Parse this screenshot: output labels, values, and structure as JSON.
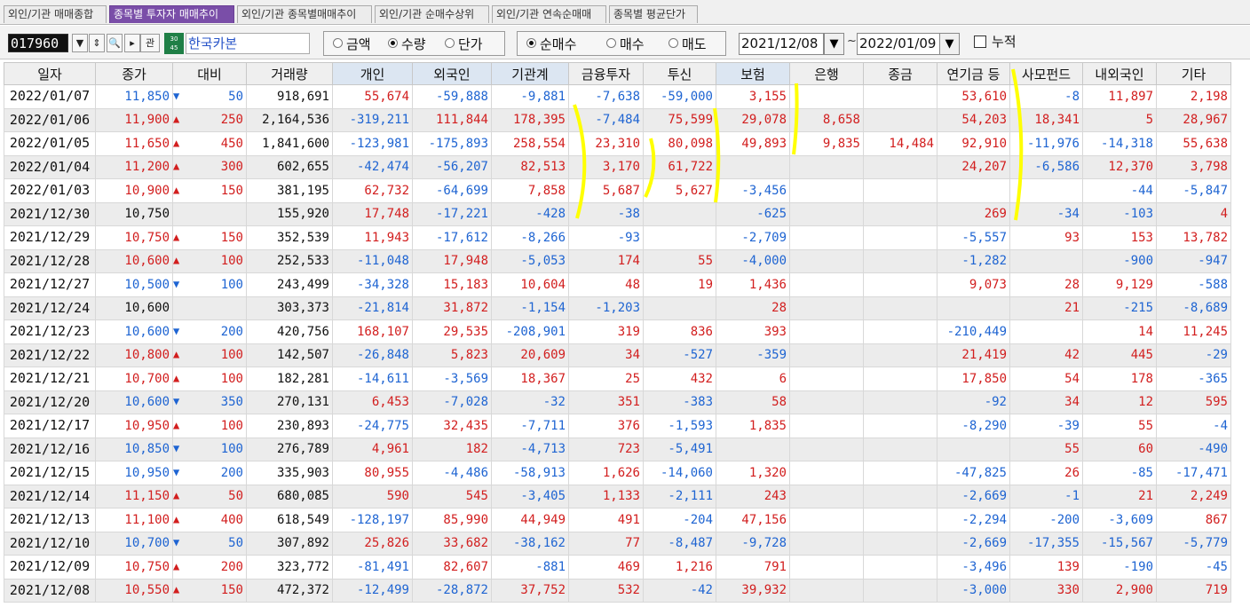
{
  "tabs": [
    "외인/기관 매매종합",
    "종목별 투자자 매매추이",
    "외인/기관 종목별매매추이",
    "외인/기관 순매수상위",
    "외인/기관 연속순매매",
    "종목별 평균단가"
  ],
  "active_tab_index": 1,
  "stock": {
    "code": "017960",
    "badge_top": "30",
    "badge_bottom": "45",
    "name": "한국카본",
    "link_label": "관"
  },
  "value_type": {
    "options": [
      "금액",
      "수량",
      "단가"
    ],
    "selected": "수량"
  },
  "trade_type": {
    "options": [
      "순매수",
      "매수",
      "매도"
    ],
    "selected": "순매수"
  },
  "date_range": {
    "from": "2021/12/08",
    "to": "2022/01/09",
    "separator": "~"
  },
  "cumulative": {
    "label": "누적",
    "checked": false
  },
  "columns": [
    "일자",
    "종가",
    "대비",
    "거래량",
    "개인",
    "외국인",
    "기관계",
    "금융투자",
    "투신",
    "보험",
    "은행",
    "종금",
    "연기금 등",
    "사모펀드",
    "내외국인",
    "기타"
  ],
  "colors": {
    "up": "#d21e1e",
    "down": "#1e64d2",
    "active_tab": "#7a4ea8",
    "highlight": "#ffff00"
  },
  "rows": [
    [
      "2022/01/07",
      "11,850",
      "down",
      "50",
      "918,691",
      "55,674",
      "-59,888",
      "-9,881",
      "-7,638",
      "-59,000",
      "3,155",
      "",
      "",
      "53,610",
      "-8",
      "11,897",
      "2,198"
    ],
    [
      "2022/01/06",
      "11,900",
      "up",
      "250",
      "2,164,536",
      "-319,211",
      "111,844",
      "178,395",
      "-7,484",
      "75,599",
      "29,078",
      "8,658",
      "",
      "54,203",
      "18,341",
      "5",
      "28,967"
    ],
    [
      "2022/01/05",
      "11,650",
      "up",
      "450",
      "1,841,600",
      "-123,981",
      "-175,893",
      "258,554",
      "23,310",
      "80,098",
      "49,893",
      "9,835",
      "14,484",
      "92,910",
      "-11,976",
      "-14,318",
      "55,638"
    ],
    [
      "2022/01/04",
      "11,200",
      "up",
      "300",
      "602,655",
      "-42,474",
      "-56,207",
      "82,513",
      "3,170",
      "61,722",
      "",
      "",
      "",
      "24,207",
      "-6,586",
      "12,370",
      "3,798"
    ],
    [
      "2022/01/03",
      "10,900",
      "up",
      "150",
      "381,195",
      "62,732",
      "-64,699",
      "7,858",
      "5,687",
      "5,627",
      "-3,456",
      "",
      "",
      "",
      "",
      "-44",
      "-5,847"
    ],
    [
      "2021/12/30",
      "10,750",
      "flat",
      "",
      "155,920",
      "17,748",
      "-17,221",
      "-428",
      "-38",
      "",
      "-625",
      "",
      "",
      "269",
      "-34",
      "-103",
      "4"
    ],
    [
      "2021/12/29",
      "10,750",
      "up",
      "150",
      "352,539",
      "11,943",
      "-17,612",
      "-8,266",
      "-93",
      "",
      "-2,709",
      "",
      "",
      "-5,557",
      "93",
      "153",
      "13,782"
    ],
    [
      "2021/12/28",
      "10,600",
      "up",
      "100",
      "252,533",
      "-11,048",
      "17,948",
      "-5,053",
      "174",
      "55",
      "-4,000",
      "",
      "",
      "-1,282",
      "",
      "-900",
      "-947"
    ],
    [
      "2021/12/27",
      "10,500",
      "down",
      "100",
      "243,499",
      "-34,328",
      "15,183",
      "10,604",
      "48",
      "19",
      "1,436",
      "",
      "",
      "9,073",
      "28",
      "9,129",
      "-588"
    ],
    [
      "2021/12/24",
      "10,600",
      "flat",
      "",
      "303,373",
      "-21,814",
      "31,872",
      "-1,154",
      "-1,203",
      "",
      "28",
      "",
      "",
      "",
      "21",
      "-215",
      "-8,689"
    ],
    [
      "2021/12/23",
      "10,600",
      "down",
      "200",
      "420,756",
      "168,107",
      "29,535",
      "-208,901",
      "319",
      "836",
      "393",
      "",
      "",
      "-210,449",
      "",
      "14",
      "11,245"
    ],
    [
      "2021/12/22",
      "10,800",
      "up",
      "100",
      "142,507",
      "-26,848",
      "5,823",
      "20,609",
      "34",
      "-527",
      "-359",
      "",
      "",
      "21,419",
      "42",
      "445",
      "-29"
    ],
    [
      "2021/12/21",
      "10,700",
      "up",
      "100",
      "182,281",
      "-14,611",
      "-3,569",
      "18,367",
      "25",
      "432",
      "6",
      "",
      "",
      "17,850",
      "54",
      "178",
      "-365"
    ],
    [
      "2021/12/20",
      "10,600",
      "down",
      "350",
      "270,131",
      "6,453",
      "-7,028",
      "-32",
      "351",
      "-383",
      "58",
      "",
      "",
      "-92",
      "34",
      "12",
      "595"
    ],
    [
      "2021/12/17",
      "10,950",
      "up",
      "100",
      "230,893",
      "-24,775",
      "32,435",
      "-7,711",
      "376",
      "-1,593",
      "1,835",
      "",
      "",
      "-8,290",
      "-39",
      "55",
      "-4"
    ],
    [
      "2021/12/16",
      "10,850",
      "down",
      "100",
      "276,789",
      "4,961",
      "182",
      "-4,713",
      "723",
      "-5,491",
      "",
      "",
      "",
      "",
      "55",
      "60",
      "-490"
    ],
    [
      "2021/12/15",
      "10,950",
      "down",
      "200",
      "335,903",
      "80,955",
      "-4,486",
      "-58,913",
      "1,626",
      "-14,060",
      "1,320",
      "",
      "",
      "-47,825",
      "26",
      "-85",
      "-17,471"
    ],
    [
      "2021/12/14",
      "11,150",
      "up",
      "50",
      "680,085",
      "590",
      "545",
      "-3,405",
      "1,133",
      "-2,111",
      "243",
      "",
      "",
      "-2,669",
      "-1",
      "21",
      "2,249"
    ],
    [
      "2021/12/13",
      "11,100",
      "up",
      "400",
      "618,549",
      "-128,197",
      "85,990",
      "44,949",
      "491",
      "-204",
      "47,156",
      "",
      "",
      "-2,294",
      "-200",
      "-3,609",
      "867"
    ],
    [
      "2021/12/10",
      "10,700",
      "down",
      "50",
      "307,892",
      "25,826",
      "33,682",
      "-38,162",
      "77",
      "-8,487",
      "-9,728",
      "",
      "",
      "-2,669",
      "-17,355",
      "-15,567",
      "-5,779"
    ],
    [
      "2021/12/09",
      "10,750",
      "up",
      "200",
      "323,772",
      "-81,491",
      "82,607",
      "-881",
      "469",
      "1,216",
      "791",
      "",
      "",
      "-3,496",
      "139",
      "-190",
      "-45"
    ],
    [
      "2021/12/08",
      "10,550",
      "up",
      "150",
      "472,372",
      "-12,499",
      "-28,872",
      "37,752",
      "532",
      "-42",
      "39,932",
      "",
      "",
      "-3,000",
      "330",
      "2,900",
      "719"
    ]
  ]
}
